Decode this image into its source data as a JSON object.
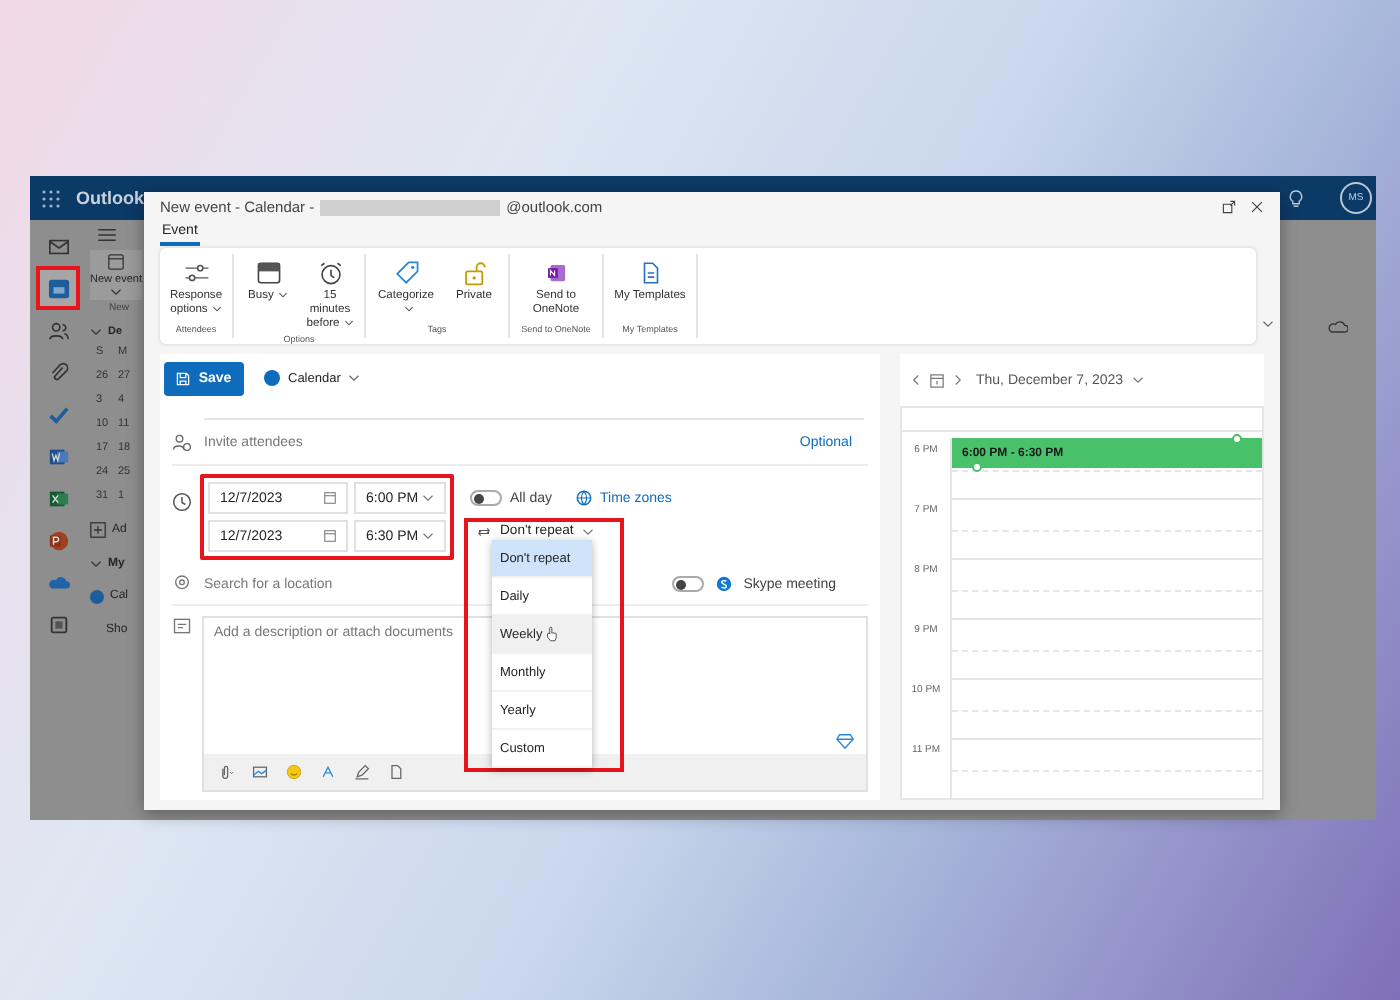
{
  "outlook": {
    "app_name": "Outlook",
    "avatar": "MS",
    "rail": [
      {
        "kind": "mail",
        "selected": false,
        "highlighted": false
      },
      {
        "kind": "calendar",
        "selected": true,
        "highlighted": true
      },
      {
        "kind": "people",
        "selected": false,
        "highlighted": false
      },
      {
        "kind": "attach",
        "selected": false,
        "highlighted": false
      },
      {
        "kind": "todo",
        "selected": false,
        "highlighted": false
      },
      {
        "kind": "word",
        "selected": false,
        "highlighted": false
      },
      {
        "kind": "excel",
        "selected": false,
        "highlighted": false
      },
      {
        "kind": "powerpoint",
        "selected": false,
        "highlighted": false
      },
      {
        "kind": "onedrive",
        "selected": false,
        "highlighted": false
      },
      {
        "kind": "apps",
        "selected": false,
        "highlighted": false
      }
    ],
    "new_event": "New event",
    "new_group": "New",
    "mini_calendar": {
      "month": "De",
      "weekdays": [
        "S",
        "M"
      ],
      "rows": [
        [
          "26",
          "27"
        ],
        [
          "3",
          "4"
        ],
        [
          "10",
          "11"
        ],
        [
          "17",
          "18"
        ],
        [
          "24",
          "25"
        ],
        [
          "31",
          "1"
        ]
      ]
    },
    "add_link": "Ad",
    "section": "My",
    "calendar_item": {
      "label": "Cal",
      "checked": true
    },
    "show_link": "Sho"
  },
  "dialog": {
    "title_prefix": "New event - Calendar -",
    "title_suffix": "@outlook.com",
    "tabs": [
      {
        "label": "Event",
        "selected": true
      }
    ],
    "ribbon": [
      {
        "group": "Attendees",
        "buttons": [
          {
            "kind": "sliders",
            "label": "Response options",
            "dropdown": true
          }
        ]
      },
      {
        "group": "Options",
        "buttons": [
          {
            "kind": "busy",
            "label": "Busy",
            "dropdown": true
          },
          {
            "kind": "alarm",
            "label": "15 minutes before",
            "dropdown": true
          }
        ]
      },
      {
        "group": "Tags",
        "buttons": [
          {
            "kind": "tag",
            "label": "Categorize",
            "dropdown": true
          },
          {
            "kind": "lock",
            "label": "Private",
            "dropdown": false
          }
        ]
      },
      {
        "group": "Send to OneNote",
        "buttons": [
          {
            "kind": "onenote",
            "label": "Send to OneNote",
            "dropdown": false
          }
        ]
      },
      {
        "group": "My Templates",
        "buttons": [
          {
            "kind": "template",
            "label": "My Templates",
            "dropdown": false
          }
        ]
      }
    ],
    "form": {
      "save": "Save",
      "calendar": "Calendar",
      "attendees_placeholder": "Invite attendees",
      "optional": "Optional",
      "datetime_highlighted": true,
      "start_date": "12/7/2023",
      "start_time": "6:00 PM",
      "end_date": "12/7/2023",
      "end_time": "6:30 PM",
      "all_day": {
        "label": "All day",
        "on": false
      },
      "time_zones": "Time zones",
      "repeat": {
        "value": "Don't repeat",
        "highlighted": true,
        "options": [
          {
            "label": "Don't repeat",
            "selected": true,
            "hovered": false
          },
          {
            "label": "Daily",
            "selected": false,
            "hovered": false
          },
          {
            "label": "Weekly",
            "selected": false,
            "hovered": true
          },
          {
            "label": "Monthly",
            "selected": false,
            "hovered": false
          },
          {
            "label": "Yearly",
            "selected": false,
            "hovered": false
          },
          {
            "label": "Custom",
            "selected": false,
            "hovered": false
          }
        ]
      },
      "location_placeholder": "Search for a location",
      "skype": {
        "label": "Skype meeting",
        "on": false
      },
      "description_placeholder": "Add a description or attach documents"
    },
    "day_view": {
      "date": "Thu, December 7, 2023",
      "hours": [
        "6 PM",
        "7 PM",
        "8 PM",
        "9 PM",
        "10 PM",
        "11 PM"
      ],
      "event": "6:00 PM - 6:30 PM"
    }
  }
}
